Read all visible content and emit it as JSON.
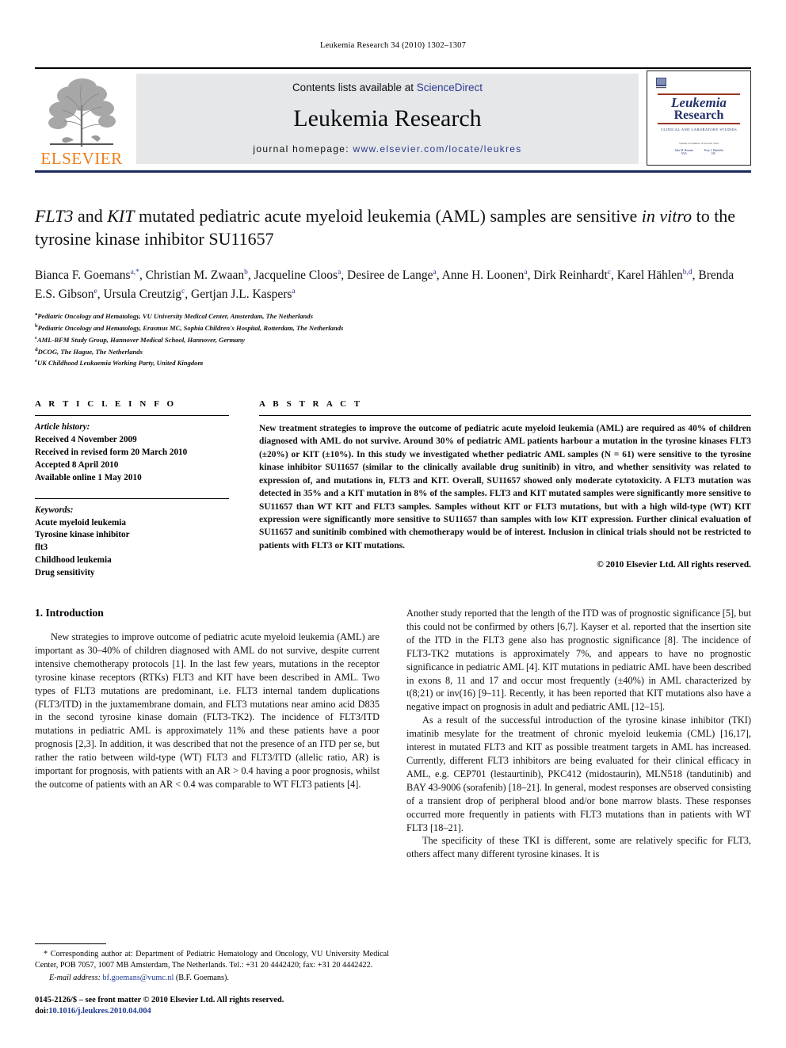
{
  "running_head": "Leukemia Research 34 (2010) 1302–1307",
  "masthead": {
    "publisher_name": "ELSEVIER",
    "contents_prefix": "Contents lists available at ",
    "contents_link": "ScienceDirect",
    "journal_title": "Leukemia Research",
    "homepage_prefix": "journal homepage: ",
    "homepage_url": "www.elsevier.com/locate/leukres",
    "cover": {
      "line1": "Leukemia",
      "line2": "Research",
      "subtitle": "CLINICAL AND LABORATORY STUDIES",
      "meta": "Volume 34  Number 10  October 2010",
      "editor1": "John M. Bennett",
      "editor1_role": "USA",
      "editor2": "Terry J. Hamblin",
      "editor2_role": "UK"
    }
  },
  "article": {
    "title_part1": "FLT3",
    "title_part2": " and ",
    "title_part3": "KIT",
    "title_part4": " mutated pediatric acute myeloid leukemia (AML) samples are sensitive ",
    "title_part5": "in vitro",
    "title_part6": " to the tyrosine kinase inhibitor SU11657",
    "title_plain": "FLT3 and KIT mutated pediatric acute myeloid leukemia (AML) samples are sensitive in vitro to the tyrosine kinase inhibitor SU11657",
    "authors": [
      {
        "name": "Bianca F. Goemans",
        "marks": "a,*"
      },
      {
        "name": "Christian M. Zwaan",
        "marks": "b"
      },
      {
        "name": "Jacqueline Cloos",
        "marks": "a"
      },
      {
        "name": "Desiree de Lange",
        "marks": "a"
      },
      {
        "name": "Anne H. Loonen",
        "marks": "a"
      },
      {
        "name": "Dirk Reinhardt",
        "marks": "c"
      },
      {
        "name": "Karel Hählen",
        "marks": "b,d"
      },
      {
        "name": "Brenda E.S. Gibson",
        "marks": "e"
      },
      {
        "name": "Ursula Creutzig",
        "marks": "c"
      },
      {
        "name": "Gertjan J.L. Kaspers",
        "marks": "a"
      }
    ],
    "affiliations": [
      {
        "mark": "a",
        "text": "Pediatric Oncology and Hematology, VU University Medical Center, Amsterdam, The Netherlands"
      },
      {
        "mark": "b",
        "text": "Pediatric Oncology and Hematology, Erasmus MC, Sophia Children's Hospital, Rotterdam, The Netherlands"
      },
      {
        "mark": "c",
        "text": "AML-BFM Study Group, Hannover Medical School, Hannover, Germany"
      },
      {
        "mark": "d",
        "text": "DCOG, The Hague, The Netherlands"
      },
      {
        "mark": "e",
        "text": "UK Childhood Leukaemia Working Party, United Kingdom"
      }
    ]
  },
  "article_info": {
    "heading": "A R T I C L E   I N F O",
    "history_label": "Article history:",
    "history": [
      "Received 4 November 2009",
      "Received in revised form 20 March 2010",
      "Accepted 8 April 2010",
      "Available online 1 May 2010"
    ],
    "keywords_label": "Keywords:",
    "keywords": [
      "Acute myeloid leukemia",
      "Tyrosine kinase inhibitor",
      "flt3",
      "Childhood leukemia",
      "Drug sensitivity"
    ]
  },
  "abstract": {
    "heading": "A B S T R A C T",
    "text": "New treatment strategies to improve the outcome of pediatric acute myeloid leukemia (AML) are required as 40% of children diagnosed with AML do not survive. Around 30% of pediatric AML patients harbour a mutation in the tyrosine kinases FLT3 (±20%) or KIT (±10%). In this study we investigated whether pediatric AML samples (N = 61) were sensitive to the tyrosine kinase inhibitor SU11657 (similar to the clinically available drug sunitinib) in vitro, and whether sensitivity was related to expression of, and mutations in, FLT3 and KIT. Overall, SU11657 showed only moderate cytotoxicity. A FLT3 mutation was detected in 35% and a KIT mutation in 8% of the samples. FLT3 and KIT mutated samples were significantly more sensitive to SU11657 than WT KIT and FLT3 samples. Samples without KIT or FLT3 mutations, but with a high wild-type (WT) KIT expression were significantly more sensitive to SU11657 than samples with low KIT expression. Further clinical evaluation of SU11657 and sunitinib combined with chemotherapy would be of interest. Inclusion in clinical trials should not be restricted to patients with FLT3 or KIT mutations.",
    "copyright": "© 2010 Elsevier Ltd. All rights reserved."
  },
  "introduction": {
    "heading": "1. Introduction",
    "left_para1": "New strategies to improve outcome of pediatric acute myeloid leukemia (AML) are important as 30–40% of children diagnosed with AML do not survive, despite current intensive chemotherapy protocols [1]. In the last few years, mutations in the receptor tyrosine kinase receptors (RTKs) FLT3 and KIT have been described in AML. Two types of FLT3 mutations are predominant, i.e. FLT3 internal tandem duplications (FLT3/ITD) in the juxtamembrane domain, and FLT3 mutations near amino acid D835 in the second tyrosine kinase domain (FLT3-TK2). The incidence of FLT3/ITD mutations in pediatric AML is approximately 11% and these patients have a poor prognosis [2,3]. In addition, it was described that not the presence of an ITD per se, but rather the ratio between wild-type (WT) FLT3 and FLT3/ITD (allelic ratio, AR) is important for prognosis, with patients with an AR > 0.4 having a poor prognosis, whilst the outcome of patients with an AR < 0.4 was comparable to WT FLT3 patients [4].",
    "right_para1": "Another study reported that the length of the ITD was of prognostic significance [5], but this could not be confirmed by others [6,7]. Kayser et al. reported that the insertion site of the ITD in the FLT3 gene also has prognostic significance [8]. The incidence of FLT3-TK2 mutations is approximately 7%, and appears to have no prognostic significance in pediatric AML [4]. KIT mutations in pediatric AML have been described in exons 8, 11 and 17 and occur most frequently (±40%) in AML characterized by t(8;21) or inv(16) [9–11]. Recently, it has been reported that KIT mutations also have a negative impact on prognosis in adult and pediatric AML [12–15].",
    "right_para2": "As a result of the successful introduction of the tyrosine kinase inhibitor (TKI) imatinib mesylate for the treatment of chronic myeloid leukemia (CML) [16,17], interest in mutated FLT3 and KIT as possible treatment targets in AML has increased. Currently, different FLT3 inhibitors are being evaluated for their clinical efficacy in AML, e.g. CEP701 (lestaurtinib), PKC412 (midostaurin), MLN518 (tandutinib) and BAY 43-9006 (sorafenib) [18–21]. In general, modest responses are observed consisting of a transient drop of peripheral blood and/or bone marrow blasts. These responses occurred more frequently in patients with FLT3 mutations than in patients with WT FLT3 [18–21].",
    "right_para3": "The specificity of these TKI is different, some are relatively specific for FLT3, others affect many different tyrosine kinases. It is"
  },
  "footnote": {
    "corresponding": "* Corresponding author at: Department of Pediatric Hematology and Oncology, VU University Medical Center, POB 7057, 1007 MB Amsterdam, The Netherlands. Tel.: +31 20 4442420; fax: +31 20 4442422.",
    "email_label": "E-mail address:",
    "email": "bf.goemans@vumc.nl",
    "email_suffix": "(B.F. Goemans).",
    "issn_line": "0145-2126/$ – see front matter © 2010 Elsevier Ltd. All rights reserved.",
    "doi_label": "doi:",
    "doi_value": "10.1016/j.leukres.2010.04.004"
  },
  "colors": {
    "link": "#2a3b8f",
    "ref": "#1f3a93",
    "elsevier_orange": "#F07D1A",
    "cover_blue": "#23306b",
    "band_gray": "#e6e7e8",
    "rule_navy": "#1b2a5e"
  }
}
